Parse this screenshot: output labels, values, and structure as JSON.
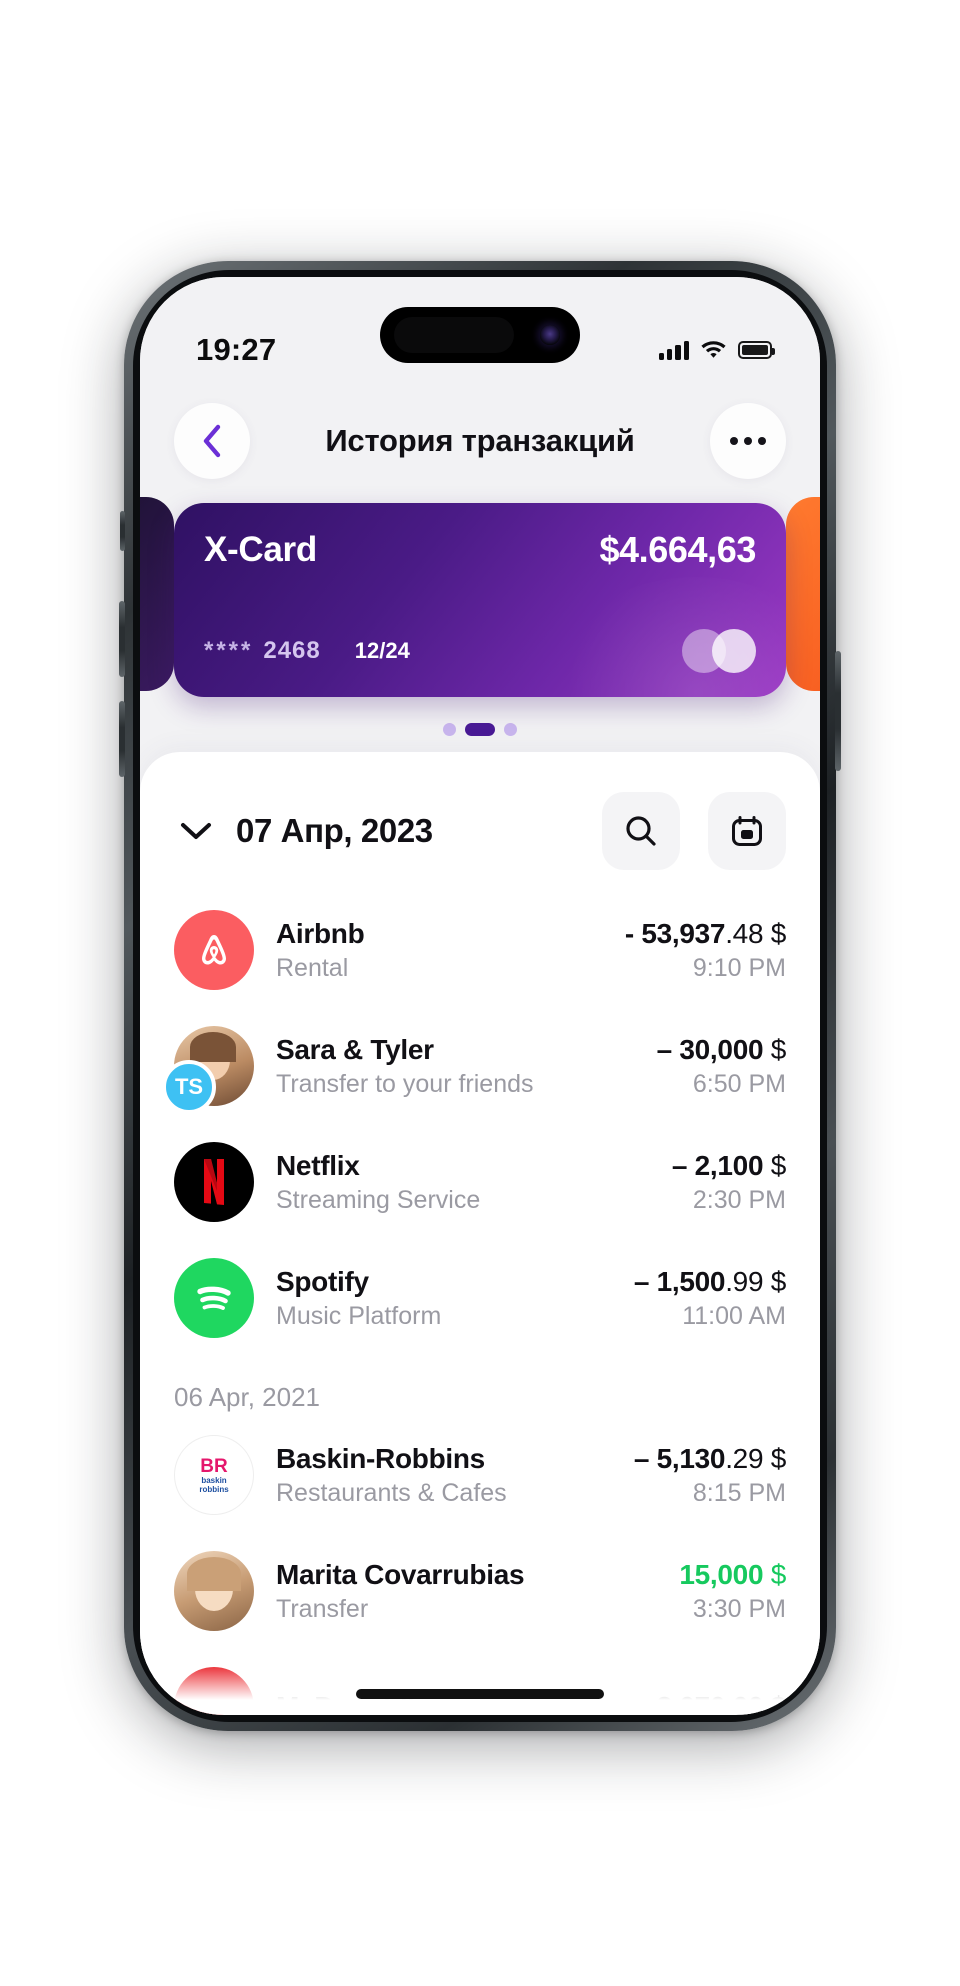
{
  "status_bar": {
    "time": "19:27",
    "signal_icon": "cellular-signal-icon",
    "wifi_icon": "wifi-icon",
    "battery_icon": "battery-full-icon"
  },
  "header": {
    "back_icon": "chevron-left-icon",
    "title": "История транзакций",
    "more_icon": "more-horizontal-icon"
  },
  "card": {
    "name": "X-Card",
    "balance": "$4.664,63",
    "masked_stars": "****",
    "last4": "2468",
    "expiry": "12/24",
    "network_icon": "mastercard-icon",
    "gradient_start": "#2f1163",
    "gradient_end": "#9b39c4",
    "peek_left_color": "#3a1a60",
    "peek_right_color": "#f75c20"
  },
  "pager": {
    "total": 3,
    "active_index": 1
  },
  "sheet": {
    "collapse_icon": "chevron-down-icon",
    "date": "07 Апр, 2023",
    "search_icon": "search-icon",
    "calendar_icon": "calendar-icon"
  },
  "transactions": [
    {
      "avatar": "airbnb-logo",
      "title": "Airbnb",
      "subtitle": "Rental",
      "amount_main": "- 53,937",
      "amount_cents": ".48",
      "currency": "$",
      "positive": false,
      "time": "9:10 PM"
    },
    {
      "avatar": "sara-tyler-photo",
      "badge": "TS",
      "title": "Sara & Tyler",
      "subtitle": "Transfer to your friends",
      "amount_main": "– 30,000",
      "amount_cents": "",
      "currency": "$",
      "positive": false,
      "time": "6:50 PM"
    },
    {
      "avatar": "netflix-logo",
      "title": "Netflix",
      "subtitle": "Streaming Service",
      "amount_main": "– 2,100",
      "amount_cents": "",
      "currency": "$",
      "positive": false,
      "time": "2:30 PM"
    },
    {
      "avatar": "spotify-logo",
      "title": "Spotify",
      "subtitle": "Music Platform",
      "amount_main": "– 1,500",
      "amount_cents": ".99",
      "currency": "$",
      "positive": false,
      "time": "11:00 AM"
    }
  ],
  "date_separator": "06 Apr, 2021",
  "transactions2": [
    {
      "avatar": "baskin-robbins-logo",
      "title": "Baskin-Robbins",
      "subtitle": "Restaurants & Cafes",
      "amount_main": "– 5,130",
      "amount_cents": ".29",
      "currency": "$",
      "positive": false,
      "time": "8:15 PM"
    },
    {
      "avatar": "marita-photo",
      "title": "Marita Covarrubias",
      "subtitle": "Transfer",
      "amount_main": "15,000",
      "amount_cents": "",
      "currency": "$",
      "positive": true,
      "time": "3:30 PM"
    }
  ],
  "colors": {
    "accent_purple": "#4a1b96",
    "positive_green": "#16c95e",
    "muted_text": "#9a9aa2"
  }
}
